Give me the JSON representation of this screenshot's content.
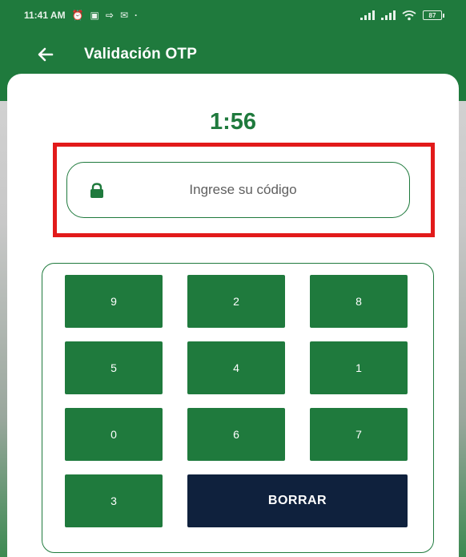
{
  "status_bar": {
    "time": "11:41 AM",
    "left_icons": [
      "alarm-icon",
      "message-icon",
      "share-icon",
      "mail-icon"
    ],
    "battery": "87"
  },
  "header": {
    "title": "Validación OTP",
    "back_icon": "arrow-left-icon"
  },
  "timer": "1:56",
  "code_input": {
    "placeholder": "Ingrese su código",
    "icon": "lock-icon"
  },
  "keypad": {
    "keys": [
      "9",
      "2",
      "8",
      "5",
      "4",
      "1",
      "0",
      "6",
      "7",
      "3"
    ],
    "delete_label": "BORRAR"
  },
  "colors": {
    "primary": "#1f7a3d",
    "delete_button": "#0f213d",
    "highlight": "#e21a1a"
  }
}
